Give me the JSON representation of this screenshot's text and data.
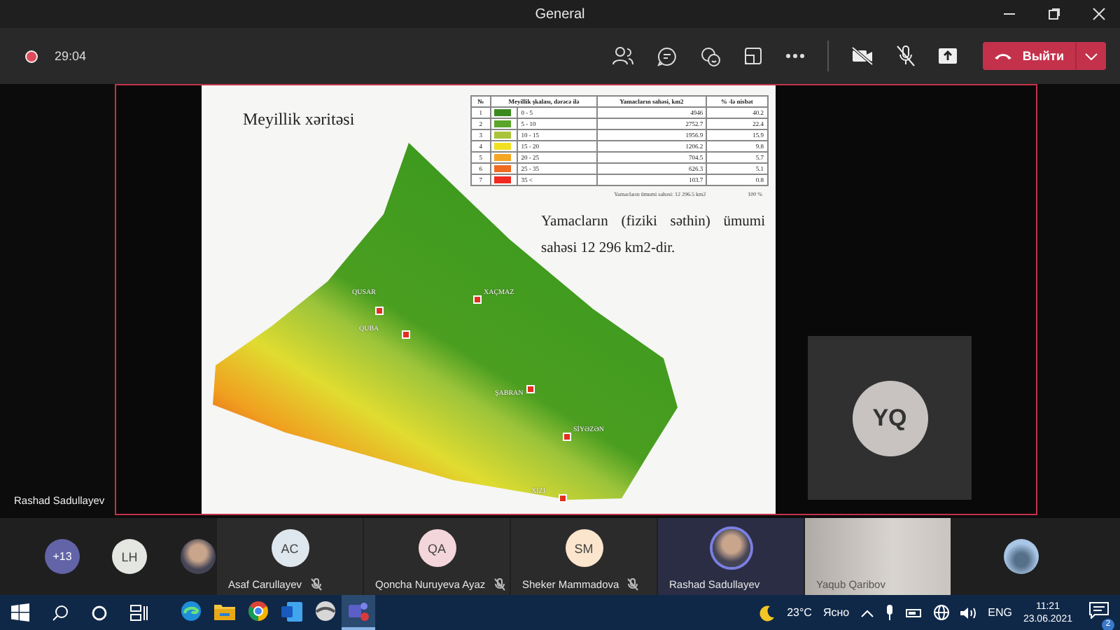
{
  "window": {
    "title": "General"
  },
  "toolbar": {
    "timer": "29:04",
    "leave_button": "Выйти"
  },
  "shared_screen": {
    "presenter": "Rashad Sadullayev",
    "slide": {
      "title": "Meyillik xəritəsi",
      "table": {
        "columns": [
          "№",
          "Meyillik şkalası, dərəcə ilə",
          "Yamacların sahəsi, km2",
          "% -lə nisbət"
        ],
        "rows": [
          {
            "number": "1",
            "color": "#3a8a1e",
            "range": "0 - 5",
            "area": "4946",
            "percent": "40.2"
          },
          {
            "number": "2",
            "color": "#5aa52a",
            "range": "5 - 10",
            "area": "2752.7",
            "percent": "22.4"
          },
          {
            "number": "3",
            "color": "#a9c43a",
            "range": "10 - 15",
            "area": "1956.9",
            "percent": "15.9"
          },
          {
            "number": "4",
            "color": "#f0e020",
            "range": "15 - 20",
            "area": "1206.2",
            "percent": "9.8"
          },
          {
            "number": "5",
            "color": "#f5a623",
            "range": "20 - 25",
            "area": "704.5",
            "percent": "5.7"
          },
          {
            "number": "6",
            "color": "#f06a20",
            "range": "25 - 35",
            "area": "626.3",
            "percent": "5.1"
          },
          {
            "number": "7",
            "color": "#f02a20",
            "range": "35 <",
            "area": "103.7",
            "percent": "0.8"
          }
        ],
        "total_label": "Yamacların ümumi sahəsi: 12 296.5 km2",
        "total_percent": "100 %"
      },
      "description": "Yamacların (fiziki səthin) ümumi sahəsi 12 296  km2-dir.",
      "towns": [
        {
          "name": "QUSAR"
        },
        {
          "name": "XAÇMAZ"
        },
        {
          "name": "QUBA"
        },
        {
          "name": "ŞABRAN"
        },
        {
          "name": "SİYƏZƏN"
        },
        {
          "name": "XIZI"
        }
      ]
    }
  },
  "self_view": {
    "initials": "YQ"
  },
  "participants": {
    "overflow": "+13",
    "avatars": [
      {
        "kind": "initials",
        "initials": "LH",
        "color": "#e3e6e1"
      },
      {
        "kind": "photo"
      }
    ],
    "tiles": [
      {
        "kind": "initials",
        "name": "Asaf Carullayev",
        "initials": "AC",
        "color": "#dfe7ee",
        "muted": true,
        "speaking": false
      },
      {
        "kind": "initials",
        "name": "Qoncha Nuruyeva Ayaz",
        "initials": "QA",
        "color": "#f3d6dc",
        "muted": true,
        "speaking": false
      },
      {
        "kind": "initials",
        "name": "Sheker Mammadova",
        "initials": "SM",
        "color": "#fbe5cc",
        "muted": true,
        "speaking": false
      },
      {
        "kind": "photo",
        "name": "Rashad Sadullayev",
        "muted": false,
        "speaking": true
      },
      {
        "kind": "video",
        "name": "Yaqub Qaribov",
        "muted": false,
        "speaking": false
      }
    ],
    "extra_avatar": {
      "kind": "photo"
    }
  },
  "taskbar": {
    "apps": [
      {
        "kind": "edge",
        "active": false
      },
      {
        "kind": "explorer",
        "active": false
      },
      {
        "kind": "chrome",
        "active": false
      },
      {
        "kind": "word",
        "active": false
      },
      {
        "kind": "disc",
        "active": false
      },
      {
        "kind": "teams",
        "active": true
      }
    ],
    "temperature": "23°C",
    "weather": "Ясно",
    "language": "ENG",
    "time": "11:21",
    "date": "23.06.2021",
    "notifications": "2"
  }
}
